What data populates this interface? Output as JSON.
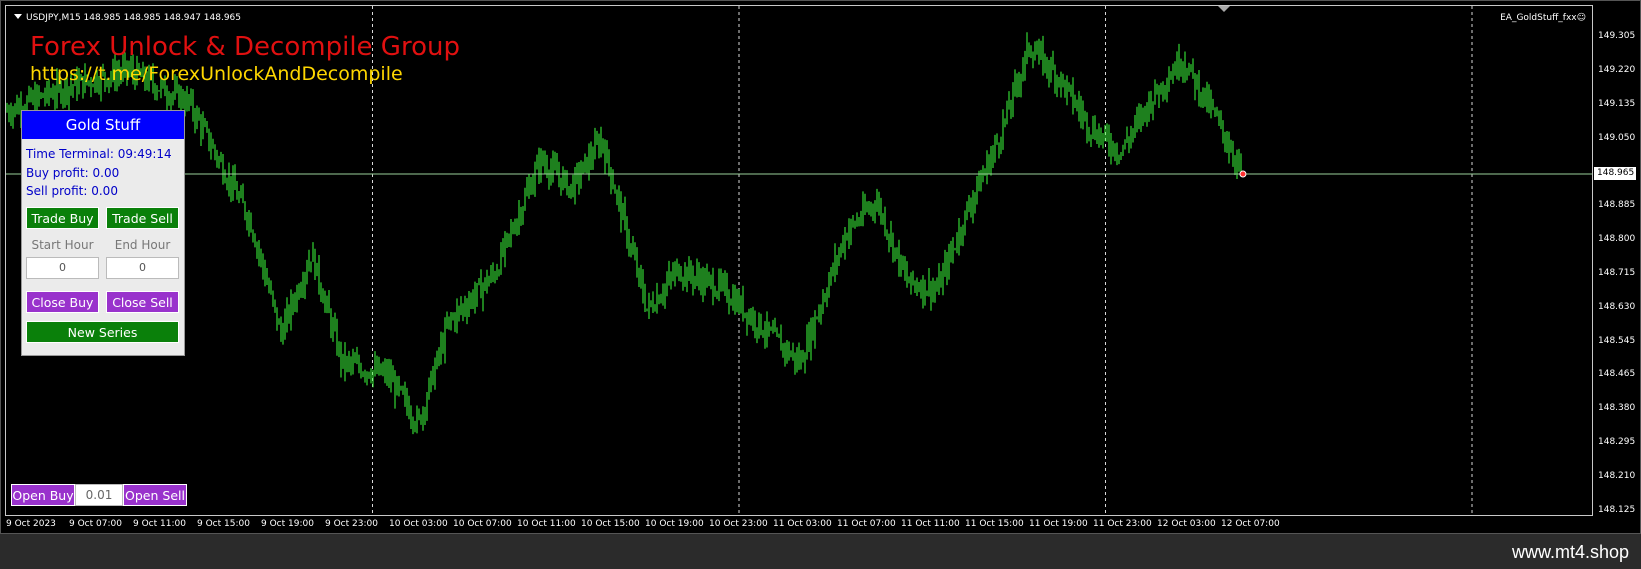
{
  "chart": {
    "symbol_info": "USDJPY,M15  148.985 148.985 148.947 148.965",
    "ea_label": "EA_GoldStuff_fxx☺",
    "brand_title": "Forex Unlock & Decompile Group",
    "brand_url": "https://t.me/ForexUnlockAndDecompile",
    "current_price": "148.965",
    "colors": {
      "background": "#000000",
      "bars": "#3cff3c",
      "bid_line": "#9ad09a",
      "separator": "#ffffff"
    },
    "y_ticks": [
      "149.305",
      "149.220",
      "149.135",
      "149.050",
      "148.885",
      "148.800",
      "148.715",
      "148.630",
      "148.545",
      "148.465",
      "148.380",
      "148.295",
      "148.210",
      "148.125"
    ],
    "x_ticks": [
      "9 Oct 2023",
      "9 Oct 07:00",
      "9 Oct 11:00",
      "9 Oct 15:00",
      "9 Oct 19:00",
      "9 Oct 23:00",
      "10 Oct 03:00",
      "10 Oct 07:00",
      "10 Oct 11:00",
      "10 Oct 15:00",
      "10 Oct 19:00",
      "10 Oct 23:00",
      "11 Oct 03:00",
      "11 Oct 07:00",
      "11 Oct 11:00",
      "11 Oct 15:00",
      "11 Oct 19:00",
      "11 Oct 23:00",
      "12 Oct 03:00",
      "12 Oct 07:00"
    ]
  },
  "chart_data": {
    "type": "candlestick",
    "symbol": "USDJPY",
    "timeframe": "M15",
    "ylim": [
      148.125,
      149.32
    ],
    "grid": false,
    "day_separators": [
      "10 Oct",
      "11 Oct",
      "12 Oct",
      "13 Oct"
    ],
    "current_price": 148.965,
    "approx_close_path": [
      [
        "9 Oct 00:00",
        149.12
      ],
      [
        "9 Oct 04:00",
        149.18
      ],
      [
        "9 Oct 08:00",
        149.22
      ],
      [
        "9 Oct 12:00",
        149.14
      ],
      [
        "9 Oct 16:00",
        148.85
      ],
      [
        "9 Oct 18:00",
        148.57
      ],
      [
        "9 Oct 20:00",
        148.77
      ],
      [
        "9 Oct 22:00",
        148.5
      ],
      [
        "10 Oct 01:00",
        148.47
      ],
      [
        "10 Oct 03:00",
        148.35
      ],
      [
        "10 Oct 05:00",
        148.6
      ],
      [
        "10 Oct 08:00",
        148.72
      ],
      [
        "10 Oct 11:00",
        149.0
      ],
      [
        "10 Oct 13:00",
        148.93
      ],
      [
        "10 Oct 15:00",
        149.05
      ],
      [
        "10 Oct 18:00",
        148.63
      ],
      [
        "10 Oct 20:00",
        148.73
      ],
      [
        "10 Oct 23:00",
        148.68
      ],
      [
        "11 Oct 02:00",
        148.57
      ],
      [
        "11 Oct 04:00",
        148.5
      ],
      [
        "11 Oct 07:00",
        148.82
      ],
      [
        "11 Oct 09:00",
        148.9
      ],
      [
        "11 Oct 11:00",
        148.7
      ],
      [
        "11 Oct 13:00",
        148.68
      ],
      [
        "11 Oct 15:00",
        148.88
      ],
      [
        "11 Oct 17:00",
        149.05
      ],
      [
        "11 Oct 19:00",
        149.28
      ],
      [
        "11 Oct 21:00",
        149.2
      ],
      [
        "11 Oct 23:00",
        149.08
      ],
      [
        "12 Oct 01:00",
        149.02
      ],
      [
        "12 Oct 03:00",
        149.15
      ],
      [
        "12 Oct 05:00",
        149.25
      ],
      [
        "12 Oct 07:00",
        149.12
      ],
      [
        "12 Oct 09:00",
        148.965
      ]
    ]
  },
  "panel": {
    "title": "Gold Stuff",
    "time_terminal": "Time Terminal: 09:49:14",
    "buy_profit": "Buy profit: 0.00",
    "sell_profit": "Sell profit: 0.00",
    "trade_buy_label": "Trade Buy",
    "trade_sell_label": "Trade Sell",
    "start_hour_label": "Start Hour",
    "end_hour_label": "End Hour",
    "start_hour_value": "0",
    "end_hour_value": "0",
    "close_buy_label": "Close Buy",
    "close_sell_label": "Close Sell",
    "new_series_label": "New Series",
    "colors": {
      "header": "#0000ff",
      "trade_button": "#0a800a",
      "close_button": "#9932cc"
    }
  },
  "quick_trade": {
    "open_buy_label": "Open Buy",
    "lot_value": "0.01",
    "open_sell_label": "Open Sell"
  },
  "watermark": "www.mt4.shop"
}
